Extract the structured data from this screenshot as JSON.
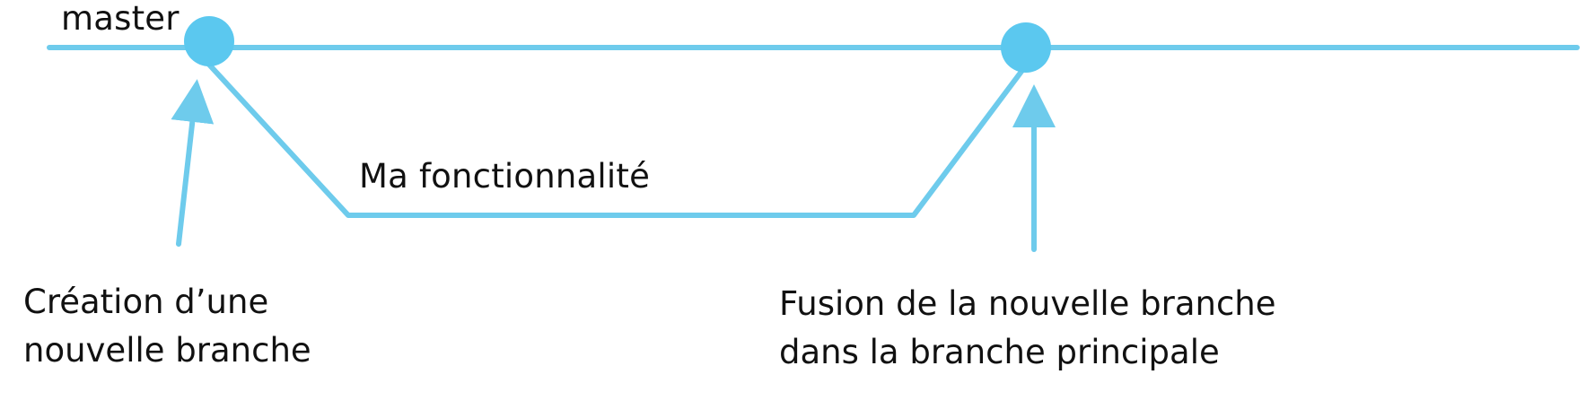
{
  "labels": {
    "main_branch": "master",
    "feature_branch": "Ma fonctionnalité"
  },
  "annotations": {
    "branch_creation": {
      "line1": "Création d’une",
      "line2": "nouvelle branche"
    },
    "branch_merge": {
      "line1": "Fusion de la nouvelle branche",
      "line2": "dans la branche principale"
    }
  },
  "colors": {
    "line": "#6ecbec",
    "node": "#5bc8ef",
    "text": "#111111"
  }
}
